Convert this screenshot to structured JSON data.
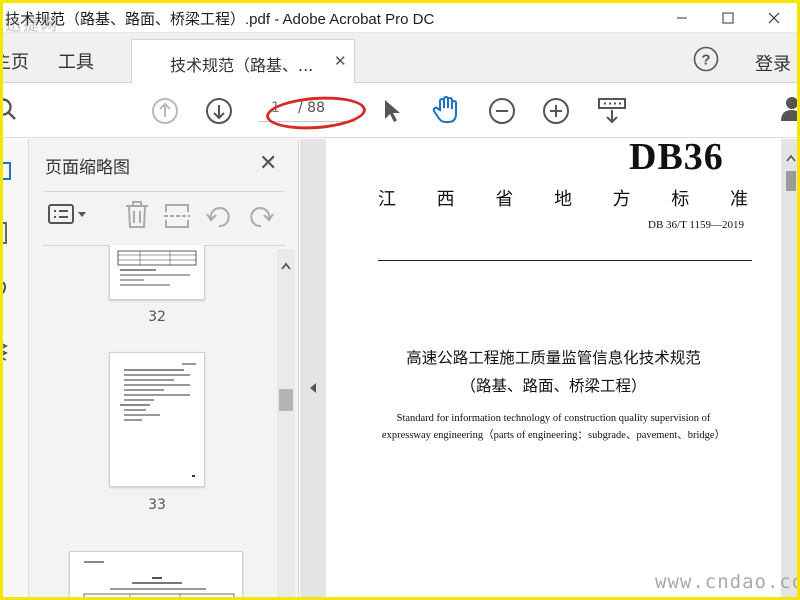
{
  "window": {
    "title": "技术规范（路基、路面、桥梁工程）.pdf - Adobe Acrobat Pro DC",
    "controls": [
      "minimize-icon",
      "maximize-icon",
      "close-icon"
    ]
  },
  "tabs": {
    "home": "主页",
    "tools": "工具",
    "document": "技术规范（路基、...",
    "login": "登录"
  },
  "toolbar": {
    "icons": [
      "search-icon",
      "prev-page-icon",
      "next-page-icon",
      "select-cursor-icon",
      "hand-tool-icon",
      "zoom-out-icon",
      "zoom-in-icon",
      "scroll-mode-icon",
      "account-icon"
    ],
    "page_current": "1",
    "page_total": "/ 88",
    "accent": "#1a73c9",
    "annotation_color": "#d72b22"
  },
  "thumbnails": {
    "panel_title": "页面缩略图",
    "pages": [
      "32",
      "33"
    ]
  },
  "document": {
    "standard_code": "DB36",
    "province_chars": [
      "江",
      "西",
      "省",
      "地",
      "方",
      "标",
      "准"
    ],
    "standard_number": "DB 36/T 1159—2019",
    "cn_title": "高速公路工程施工质量监管信息化技术规范",
    "cn_subtitle": "（路基、路面、桥梁工程）",
    "en_title_line1": "Standard for information technology of construction quality supervision of",
    "en_title_line2": "expressway engineering（parts of engineering：subgrade、pavement、bridge）"
  },
  "watermarks": {
    "top_left": "迅捷网",
    "bottom_right": "www.cndao.com"
  }
}
